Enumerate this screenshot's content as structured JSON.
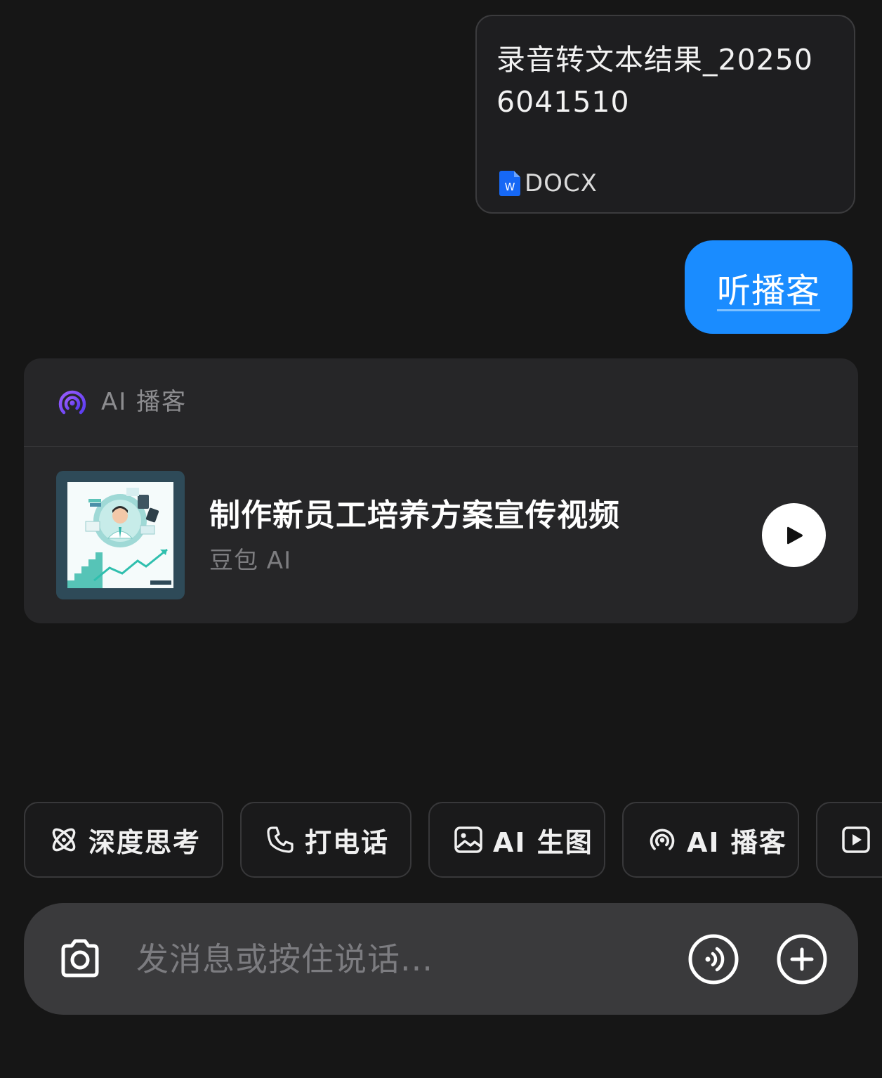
{
  "file_card": {
    "name": "录音转文本结果_202506041510",
    "type_label": "DOCX",
    "icon": "word-doc-icon",
    "icon_letter": "W"
  },
  "user_message": {
    "text": "听播客"
  },
  "podcast_card": {
    "header_label": "AI 播客",
    "header_icon": "podcast-broadcast-icon",
    "track": {
      "title": "制作新员工培养方案宣传视频",
      "author": "豆包 AI",
      "cover_icon": "podcast-cover-illustration"
    },
    "play_icon": "play-icon"
  },
  "chips": [
    {
      "label": "深度思考",
      "icon": "atom-icon"
    },
    {
      "label": "打电话",
      "icon": "phone-icon"
    },
    {
      "label": "AI 生图",
      "icon": "image-icon"
    },
    {
      "label": "AI 播客",
      "icon": "podcast-broadcast-icon"
    },
    {
      "label": "",
      "icon": "video-play-icon"
    }
  ],
  "input_bar": {
    "placeholder": "发消息或按住说话...",
    "value": "",
    "camera_icon": "camera-icon",
    "voice_icon": "voice-wave-icon",
    "plus_icon": "plus-icon"
  },
  "colors": {
    "background": "#161616",
    "user_bubble": "#1a8cff",
    "card": "#262628",
    "podcast_accent": "#7b4dff",
    "word_blue": "#1668f5"
  }
}
